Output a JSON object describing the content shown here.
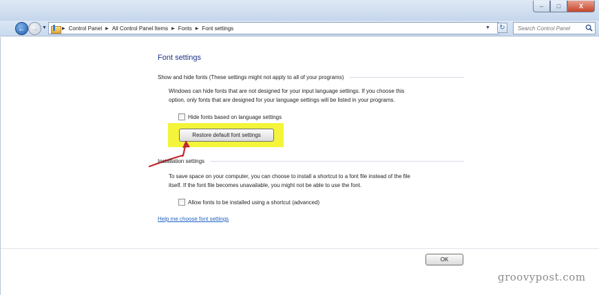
{
  "window": {
    "controls": [
      "minimize",
      "maximize",
      "close"
    ],
    "close_label": "X"
  },
  "addressbar": {
    "breadcrumbs": [
      "Control Panel",
      "All Control Panel Items",
      "Fonts",
      "Font settings"
    ],
    "search_placeholder": "Search Control Panel"
  },
  "page": {
    "title": "Font settings",
    "section_show_hide": {
      "header": "Show and hide fonts (These settings might not apply to all of your programs)",
      "description_line1": "Windows can hide fonts that are not designed for your input language settings. If you choose this",
      "description_line2": "option, only fonts that are designed for your language settings will be listed in your programs.",
      "checkbox_label": "Hide fonts based on language settings",
      "checkbox_checked": false,
      "restore_button": "Restore default font settings"
    },
    "section_installation": {
      "header": "Installation settings",
      "description_line1": "To save space on your computer, you can choose to install a shortcut to a font file instead of the file",
      "description_line2": "itself. If the font file becomes unavailable, you might not be able to use the font.",
      "checkbox_label": "Allow fonts to be installed using a shortcut (advanced)",
      "checkbox_checked": false
    },
    "help_link": "Help me choose font settings",
    "ok_button": "OK"
  },
  "annotation": {
    "highlight_color": "#f4f43a",
    "arrow_color": "#c0282d"
  },
  "watermark": "groovypost.com",
  "colors": {
    "title_blue": "#1e3287",
    "link_blue": "#1d5fbf"
  }
}
